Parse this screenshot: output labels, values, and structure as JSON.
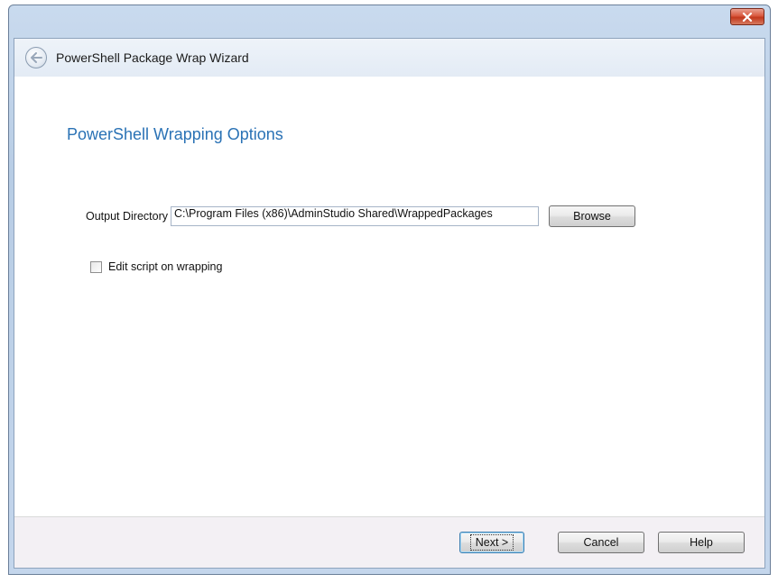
{
  "window": {
    "close_icon": "close-icon"
  },
  "wizard": {
    "title": "PowerShell Package Wrap Wizard",
    "back_icon": "back-arrow-icon"
  },
  "page": {
    "title": "PowerShell Wrapping Options",
    "output_directory_label": "Output Directory",
    "output_directory_value": "C:\\Program Files (x86)\\AdminStudio Shared\\WrappedPackages",
    "browse_label": "Browse",
    "edit_script_label": "Edit script on wrapping",
    "edit_script_checked": false
  },
  "footer": {
    "next_label": "Next >",
    "cancel_label": "Cancel",
    "help_label": "Help"
  },
  "colors": {
    "title_accent": "#2a72b5",
    "close_button": "#c2381d"
  }
}
